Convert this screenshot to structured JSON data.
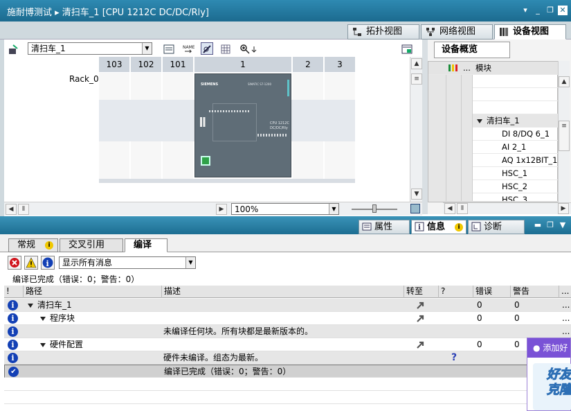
{
  "window": {
    "title": "施耐博测试 ▸ 清扫车_1 [CPU 1212C DC/DC/Rly]"
  },
  "view_tabs": [
    {
      "label": "拓扑视图"
    },
    {
      "label": "网络视图"
    },
    {
      "label": "设备视图"
    }
  ],
  "toolbar": {
    "device_select": "清扫车_1",
    "zoom": "100%"
  },
  "rack": {
    "label": "Rack_0",
    "slots": [
      "103",
      "102",
      "101",
      "1",
      "2",
      "3"
    ]
  },
  "plc": {
    "brand": "SIEMENS",
    "model_top": "SIMATIC S7-1200",
    "cpu_label": "CPU 1212C",
    "cpu_type": "DC/DC/Rly"
  },
  "overview": {
    "tab": "设备概览",
    "col_module": "模块",
    "rows": [
      "清扫车_1",
      "DI 8/DQ 6_1",
      "AI 2_1",
      "AQ 1x12BIT_1",
      "HSC_1",
      "HSC_2",
      "HSC_3"
    ]
  },
  "inspector": {
    "tabs": [
      "属性",
      "信息",
      "诊断"
    ]
  },
  "info_tabs": [
    "常规",
    "交叉引用",
    "编译"
  ],
  "filter": {
    "select": "显示所有消息"
  },
  "summary": "编译已完成（错误：0；警告：0）",
  "table": {
    "headers": {
      "bang": "!",
      "path": "路径",
      "desc": "描述",
      "goto": "转至",
      "q": "?",
      "errors": "错误",
      "warnings": "警告"
    },
    "rows": [
      {
        "path": "清扫车_1",
        "desc": "",
        "errors": "0",
        "warnings": "0",
        "indent": 0,
        "expand": true,
        "goto": true
      },
      {
        "path": "程序块",
        "desc": "",
        "errors": "0",
        "warnings": "0",
        "indent": 1,
        "expand": true,
        "goto": true
      },
      {
        "path": "",
        "desc": "未编译任何块。所有块都是最新版本的。",
        "errors": "",
        "warnings": "",
        "indent": 2,
        "expand": false,
        "goto": false
      },
      {
        "path": "硬件配置",
        "desc": "",
        "errors": "0",
        "warnings": "0",
        "indent": 1,
        "expand": true,
        "goto": true
      },
      {
        "path": "",
        "desc": "硬件未编译。组态为最新。",
        "errors": "",
        "warnings": "",
        "indent": 2,
        "expand": false,
        "goto": false,
        "help": "?"
      },
      {
        "path": "",
        "desc": "编译已完成（错误：0；警告：0）",
        "errors": "",
        "warnings": "",
        "indent": 2,
        "expand": false,
        "goto": false
      }
    ]
  },
  "popup": {
    "header": "添加好",
    "text1": "好友",
    "text2": "克隆"
  }
}
